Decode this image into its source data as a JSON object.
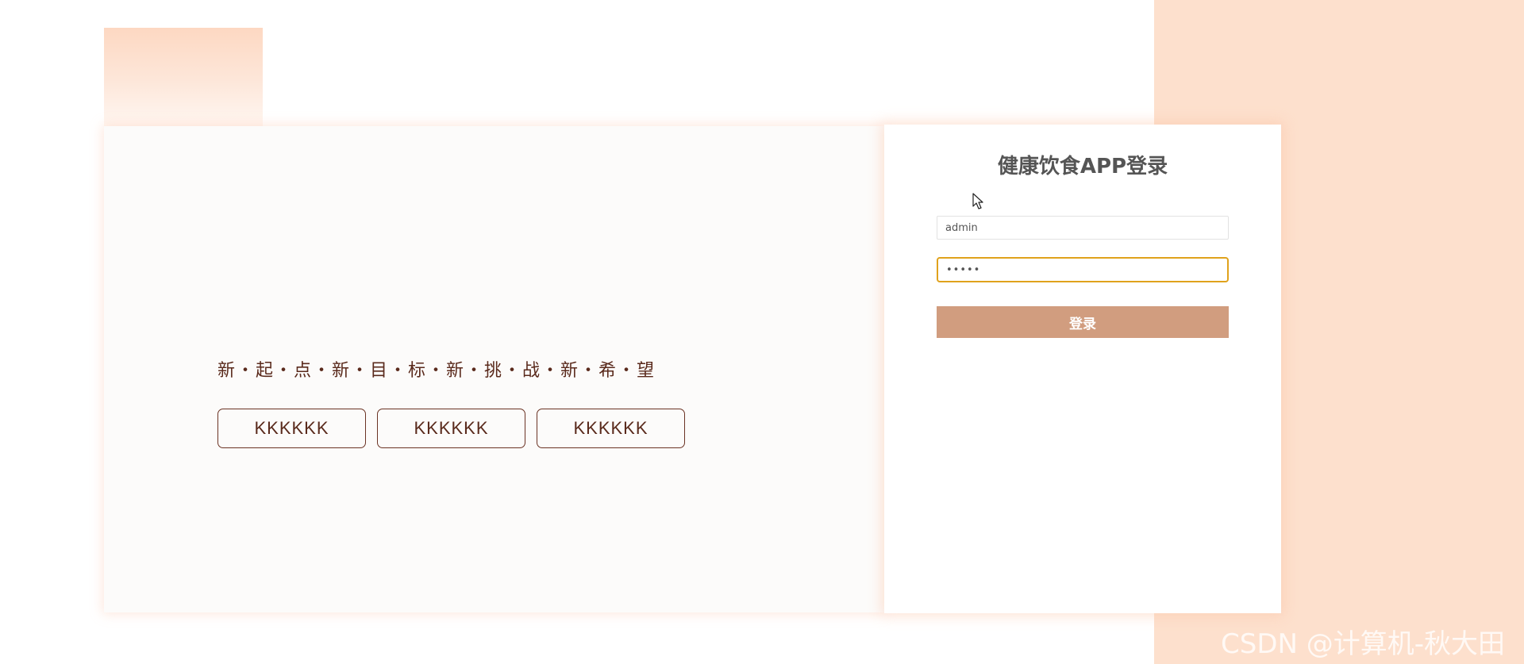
{
  "hero": {
    "slogan": "新・起・点・新・目・标・新・挑・战・新・希・望",
    "buttons": [
      {
        "label": "KKKKKK"
      },
      {
        "label": "KKKKKK"
      },
      {
        "label": "KKKKKK"
      }
    ]
  },
  "login": {
    "title": "健康饮食APP登录",
    "username_value": "admin",
    "password_value": "•••••",
    "submit_label": "登录"
  },
  "watermark": {
    "text": "CSDN @计算机-秋大田"
  },
  "colors": {
    "accent_peach": "#fde0cd",
    "login_button": "#d19d7f",
    "text_brown": "#5a2a1c",
    "focus_border": "#e0a21c"
  },
  "icons": {
    "cursor": "mouse-pointer-icon"
  }
}
